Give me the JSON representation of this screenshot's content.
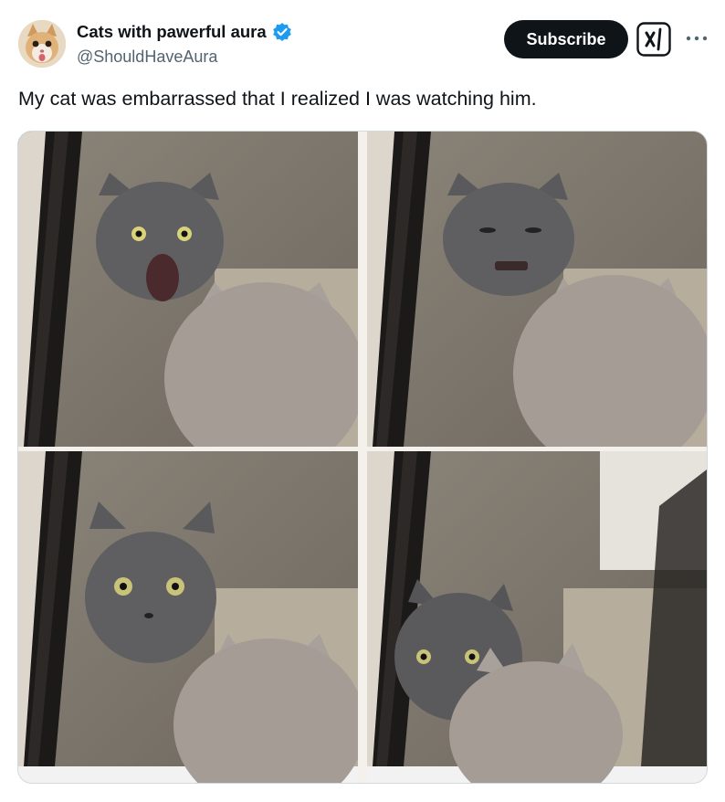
{
  "tweet": {
    "author": {
      "display_name": "Cats with pawerful aura",
      "handle": "@ShouldHaveAura",
      "verified": true,
      "verified_color": "#1d9bf0",
      "avatar_icon": "cat-avatar"
    },
    "subscribe_label": "Subscribe",
    "grok_icon": "grok-icon",
    "more_icon": "more-icon",
    "text": "My cat was embarrassed that I realized I was watching him.",
    "media": {
      "type": "photo-grid-4",
      "icon": "cat-photo"
    }
  },
  "colors": {
    "text_primary": "#0f1419",
    "text_secondary": "#536471",
    "button_bg": "#0f1419",
    "button_text": "#ffffff"
  }
}
